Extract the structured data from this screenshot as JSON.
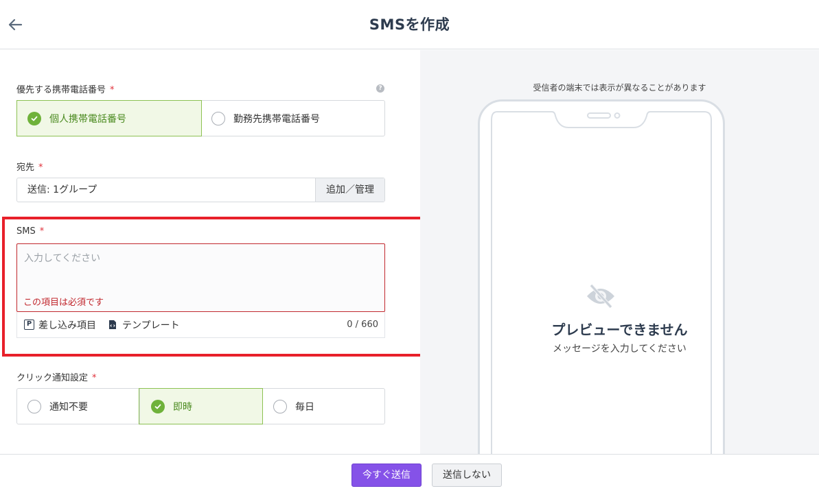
{
  "header": {
    "title": "SMSを作成",
    "back_icon": "arrow-left-icon"
  },
  "phone_priority": {
    "label": "優先する携帯電話番号",
    "required_mark": "*",
    "help_icon": "question-circle-icon",
    "help_glyph": "?",
    "options": [
      {
        "label": "個人携帯電話番号",
        "selected": true
      },
      {
        "label": "勤務先携帯電話番号",
        "selected": false
      }
    ]
  },
  "recipient": {
    "label": "宛先",
    "required_mark": "*",
    "value": "送信: 1グループ",
    "button_label": "追加／管理"
  },
  "sms": {
    "label": "SMS",
    "required_mark": "*",
    "placeholder": "入力してください",
    "error": "この項目は必須です",
    "insert_fields_icon_glyph": "P",
    "insert_fields_label": "差し込み項目",
    "template_label": "テンプレート",
    "char_count": "0 / 660"
  },
  "click_notify": {
    "label": "クリック通知設定",
    "required_mark": "*",
    "options": [
      {
        "label": "通知不要",
        "selected": false
      },
      {
        "label": "即時",
        "selected": true
      },
      {
        "label": "毎日",
        "selected": false
      }
    ]
  },
  "preview": {
    "note": "受信者の端末では表示が異なることがあります",
    "empty_title": "プレビューできません",
    "empty_subtitle": "メッセージを入力してください",
    "icon": "eye-slash-icon"
  },
  "footer": {
    "send_now_label": "今すぐ送信",
    "dont_send_label": "送信しない"
  },
  "colors": {
    "accent_purple": "#8552e8",
    "selected_green": "#6fb23a",
    "error_red": "#c1272d",
    "highlight_red": "#e8202a",
    "title_navy": "#2d3b4e"
  }
}
